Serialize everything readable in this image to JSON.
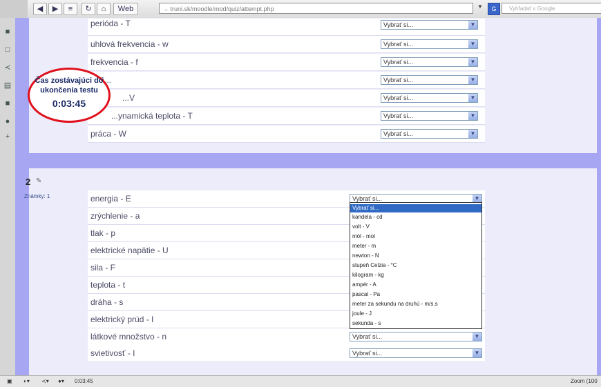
{
  "browser": {
    "url": "→ truni.sk/moodle/mod/quiz/attempt.php",
    "web_label": "Web",
    "search_placeholder": "Vyhľadať v Google"
  },
  "timer": {
    "line1": "Čas zostávajúci do",
    "line2": "ukončenia testu",
    "value": "0:03:45"
  },
  "q1": {
    "rows": [
      {
        "label": "perióda - T",
        "select": "Vybrať si..."
      },
      {
        "label": "uhlová frekvencia - w",
        "select": "Vybrať si..."
      },
      {
        "label": "frekvencia - f",
        "select": "Vybrať si..."
      },
      {
        "label": "Zač...",
        "select": "Vybrať si..."
      },
      {
        "label": "...V",
        "select": "Vybrať si..."
      },
      {
        "label": "...ynamická teplota - T",
        "select": "Vybrať si..."
      },
      {
        "label": "práca - W",
        "select": "Vybrať si..."
      }
    ]
  },
  "q2": {
    "number": "2",
    "grade": "Známky: 1",
    "rows": [
      {
        "label": "energia - E",
        "select": "Vybrať si..."
      },
      {
        "label": "zrýchlenie - a",
        "select": ""
      },
      {
        "label": "tlak - p",
        "select": ""
      },
      {
        "label": "elektrické napätie - U",
        "select": ""
      },
      {
        "label": "sila - F",
        "select": ""
      },
      {
        "label": "teplota - t",
        "select": ""
      },
      {
        "label": "dráha - s",
        "select": ""
      },
      {
        "label": "elektrický prúd - I",
        "select": ""
      },
      {
        "label": "látkové množstvo - n",
        "select": "Vybrať si..."
      },
      {
        "label": "svietivosť - I",
        "select": "Vybrať si..."
      }
    ],
    "dropdown_options": [
      "Vybrať si...",
      "kandela - cd",
      "volt - V",
      "mól - mol",
      "meter - m",
      "newton - N",
      "stupeň Celzia - °C",
      "kilogram - kg",
      "ampér - A",
      "pascal - Pa",
      "meter za sekundu na druhú - m/s.s",
      "joule - J",
      "sekunda - s"
    ]
  },
  "statusbar": {
    "timer_text": "0:03:45",
    "zoom": "Zoom (100"
  }
}
